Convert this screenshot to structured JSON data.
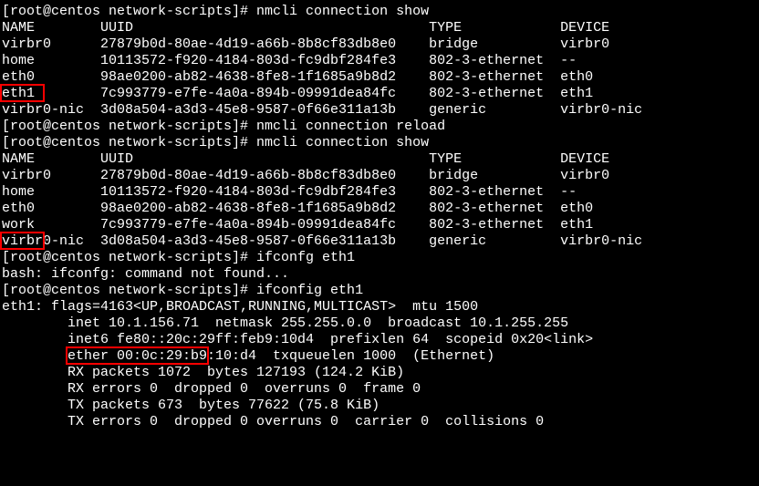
{
  "prompt": {
    "user": "root",
    "host": "centos",
    "cwd": "network-scripts",
    "full": "[root@centos network-scripts]# "
  },
  "cmd1": "nmcli connection show",
  "table1": {
    "header": {
      "name": "NAME",
      "uuid": "UUID",
      "type": "TYPE",
      "device": "DEVICE"
    },
    "rows": [
      {
        "name": "virbr0",
        "uuid": "27879b0d-80ae-4d19-a66b-8b8cf83db8e0",
        "type": "bridge",
        "device": "virbr0"
      },
      {
        "name": "home",
        "uuid": "10113572-f920-4184-803d-fc9dbf284fe3",
        "type": "802-3-ethernet",
        "device": "--"
      },
      {
        "name": "eth0",
        "uuid": "98ae0200-ab82-4638-8fe8-1f1685a9b8d2",
        "type": "802-3-ethernet",
        "device": "eth0"
      },
      {
        "name": "eth1",
        "uuid": "7c993779-e7fe-4a0a-894b-09991dea84fc",
        "type": "802-3-ethernet",
        "device": "eth1"
      },
      {
        "name": "virbr0-nic",
        "uuid": "3d08a504-a3d3-45e8-9587-0f66e311a13b",
        "type": "generic",
        "device": "virbr0-nic"
      }
    ]
  },
  "cmd2": "nmcli connection reload",
  "cmd3": "nmcli connection show",
  "table2": {
    "header": {
      "name": "NAME",
      "uuid": "UUID",
      "type": "TYPE",
      "device": "DEVICE"
    },
    "rows": [
      {
        "name": "virbr0",
        "uuid": "27879b0d-80ae-4d19-a66b-8b8cf83db8e0",
        "type": "bridge",
        "device": "virbr0"
      },
      {
        "name": "home",
        "uuid": "10113572-f920-4184-803d-fc9dbf284fe3",
        "type": "802-3-ethernet",
        "device": "--"
      },
      {
        "name": "eth0",
        "uuid": "98ae0200-ab82-4638-8fe8-1f1685a9b8d2",
        "type": "802-3-ethernet",
        "device": "eth0"
      },
      {
        "name": "work",
        "uuid": "7c993779-e7fe-4a0a-894b-09991dea84fc",
        "type": "802-3-ethernet",
        "device": "eth1"
      },
      {
        "name": "virbr0-nic",
        "uuid": "3d08a504-a3d3-45e8-9587-0f66e311a13b",
        "type": "generic",
        "device": "virbr0-nic"
      }
    ]
  },
  "cmd4": "ifconfg eth1",
  "err4": "bash: ifconfg: command not found...",
  "cmd5": "ifconfig eth1",
  "ifconfig": {
    "iface": "eth1",
    "flags_line": "eth1: flags=4163<UP,BROADCAST,RUNNING,MULTICAST>  mtu 1500",
    "inet_chunk": "inet 10.1.156.71",
    "inet_rest": "  netmask 255.255.0.0  broadcast 10.1.255.255",
    "inet6_line": "        inet6 fe80::20c:29ff:feb9:10d4  prefixlen 64  scopeid 0x20<link>",
    "ether_line": "        ether 00:0c:29:b9:10:d4  txqueuelen 1000  (Ethernet)",
    "rx_packets": "        RX packets 1072  bytes 127193 (124.2 KiB)",
    "rx_errors": "        RX errors 0  dropped 0  overruns 0  frame 0",
    "tx_packets": "        TX packets 673  bytes 77622 (75.8 KiB)",
    "tx_errors": "        TX errors 0  dropped 0 overruns 0  carrier 0  collisions 0"
  },
  "highlight_boxes": {
    "eth1_row": {
      "top_line": 5,
      "left_ch": 0,
      "width_ch": 5
    },
    "work_row": {
      "top_line": 14,
      "left_ch": 0,
      "width_ch": 5
    },
    "inet_ip": {
      "top_line": 21,
      "left_ch": 8,
      "width_ch": 17
    }
  }
}
